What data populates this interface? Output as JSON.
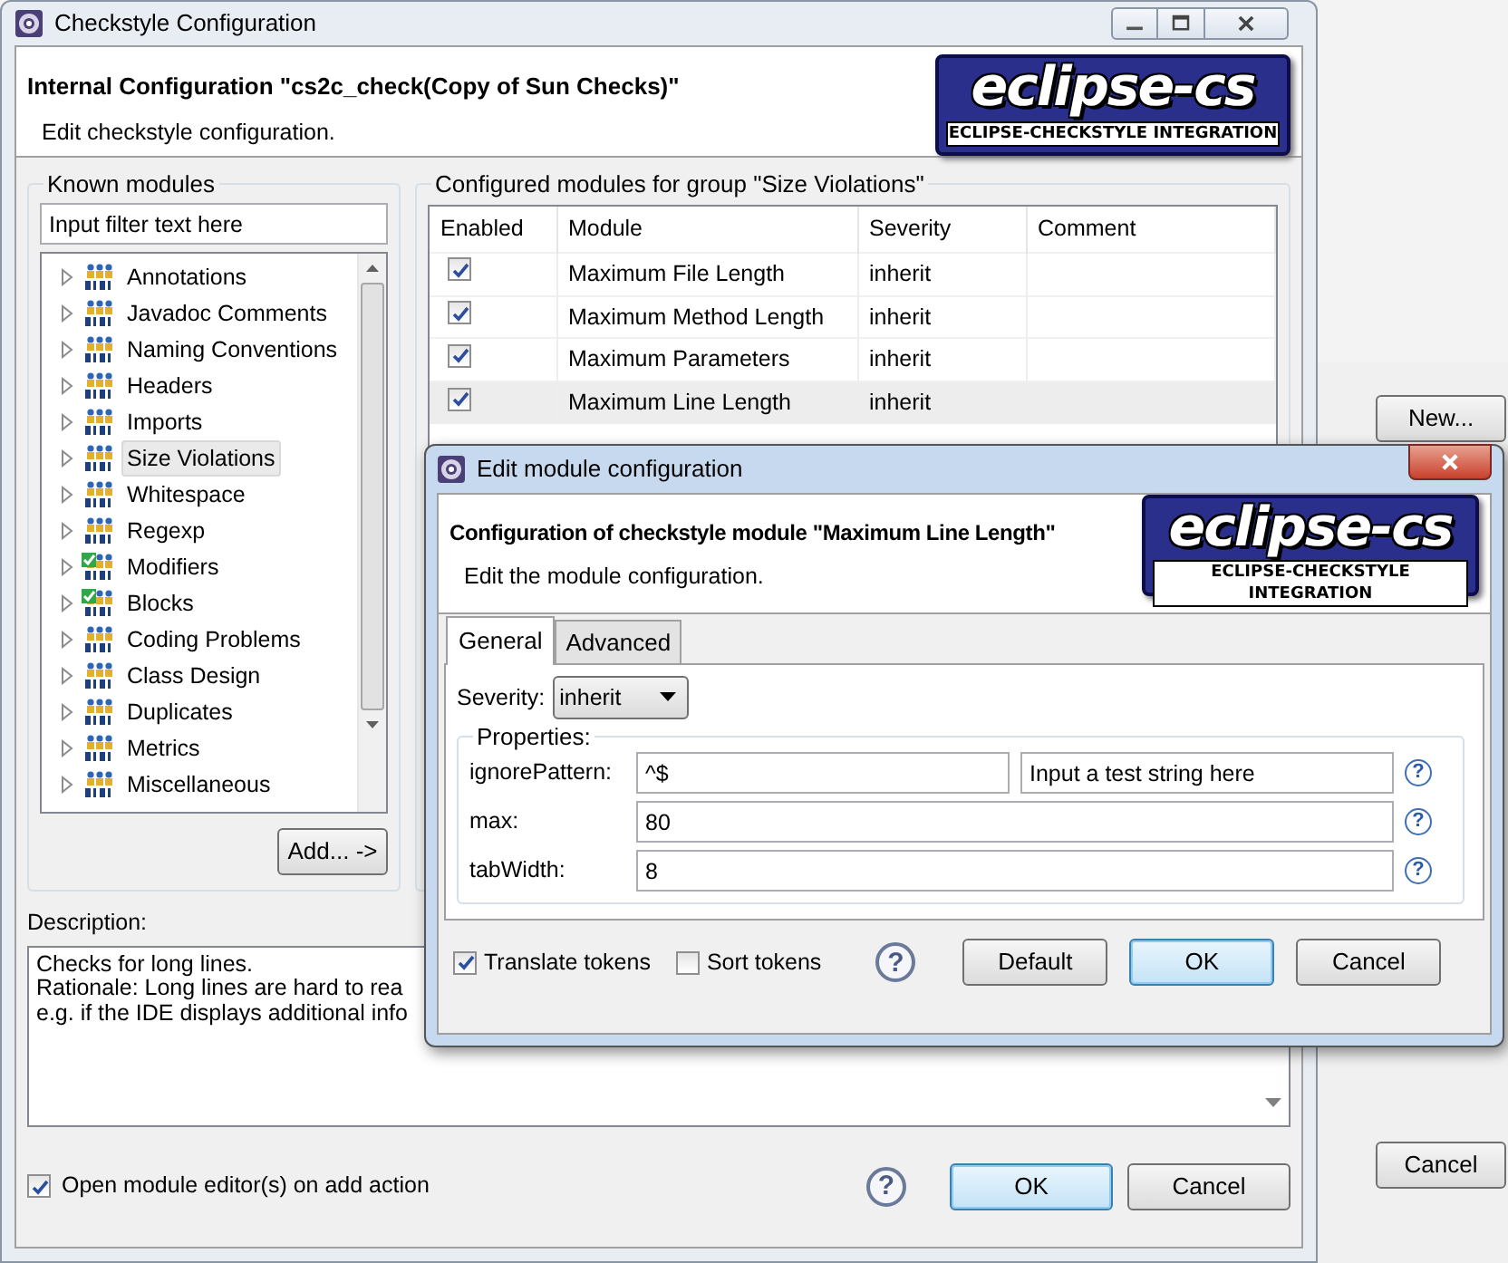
{
  "main_window": {
    "title": "Checkstyle Configuration",
    "header": {
      "title": "Internal Configuration \"cs2c_check(Copy of Sun Checks)\"",
      "subtitle": "Edit checkstyle configuration.",
      "logo": {
        "title": "eclipse-cs",
        "tagline": "ECLIPSE-CHECKSTYLE INTEGRATION"
      }
    },
    "known_modules": {
      "label": "Known modules",
      "filter_placeholder": "Input filter text here",
      "items": [
        {
          "label": "Annotations",
          "configured": false,
          "expanded": false,
          "selected": false
        },
        {
          "label": "Javadoc Comments",
          "configured": false,
          "expanded": false,
          "selected": false
        },
        {
          "label": "Naming Conventions",
          "configured": false,
          "expanded": false,
          "selected": false
        },
        {
          "label": "Headers",
          "configured": false,
          "expanded": false,
          "selected": false
        },
        {
          "label": "Imports",
          "configured": false,
          "expanded": false,
          "selected": false
        },
        {
          "label": "Size Violations",
          "configured": false,
          "expanded": false,
          "selected": true
        },
        {
          "label": "Whitespace",
          "configured": false,
          "expanded": false,
          "selected": false
        },
        {
          "label": "Regexp",
          "configured": false,
          "expanded": false,
          "selected": false
        },
        {
          "label": "Modifiers",
          "configured": true,
          "expanded": false,
          "selected": false
        },
        {
          "label": "Blocks",
          "configured": true,
          "expanded": false,
          "selected": false
        },
        {
          "label": "Coding Problems",
          "configured": false,
          "expanded": false,
          "selected": false
        },
        {
          "label": "Class Design",
          "configured": false,
          "expanded": false,
          "selected": false
        },
        {
          "label": "Duplicates",
          "configured": false,
          "expanded": false,
          "selected": false
        },
        {
          "label": "Metrics",
          "configured": false,
          "expanded": false,
          "selected": false
        },
        {
          "label": "Miscellaneous",
          "configured": false,
          "expanded": false,
          "selected": false
        }
      ],
      "add_button": "Add... ->"
    },
    "configured_modules": {
      "label": "Configured modules for group \"Size Violations\"",
      "columns": [
        "Enabled",
        "Module",
        "Severity",
        "Comment"
      ],
      "rows": [
        {
          "enabled": true,
          "module": "Maximum File Length",
          "severity": "inherit",
          "selected": false
        },
        {
          "enabled": true,
          "module": "Maximum Method Length",
          "severity": "inherit",
          "selected": false
        },
        {
          "enabled": true,
          "module": "Maximum Parameters",
          "severity": "inherit",
          "selected": false
        },
        {
          "enabled": true,
          "module": "Maximum Line Length",
          "severity": "inherit",
          "selected": true
        }
      ]
    },
    "description": {
      "label": "Description:",
      "lines": [
        "Checks for long lines.",
        "Rationale: Long lines are hard to rea",
        "e.g. if the IDE displays additional info"
      ]
    },
    "open_editor_on_add": {
      "label": "Open module editor(s) on add action",
      "checked": true
    },
    "help_icon": "?",
    "buttons": [
      {
        "label": "OK",
        "default": true
      },
      {
        "label": "Cancel",
        "default": false
      }
    ]
  },
  "dialog": {
    "title": "Edit module configuration",
    "header": {
      "title": "Configuration of checkstyle module \"Maximum Line Length\"",
      "subtitle": "Edit the module configuration.",
      "logo": {
        "title": "eclipse-cs",
        "tagline": "ECLIPSE-CHECKSTYLE INTEGRATION"
      }
    },
    "tabs": [
      {
        "label": "General",
        "selected": true
      },
      {
        "label": "Advanced",
        "selected": false
      }
    ],
    "severity": {
      "label": "Severity:",
      "value": "inherit"
    },
    "properties": {
      "label": "Properties:",
      "items": [
        {
          "name": "ignorePattern:",
          "value": "^$",
          "test_placeholder": "Input a test string here"
        },
        {
          "name": "max:",
          "value": "80"
        },
        {
          "name": "tabWidth:",
          "value": "8"
        }
      ]
    },
    "property_help_icon": "?",
    "options": [
      {
        "label": "Translate tokens",
        "checked": true
      },
      {
        "label": "Sort tokens",
        "checked": false
      }
    ],
    "help_icon": "?",
    "buttons": [
      {
        "label": "Default",
        "default": false
      },
      {
        "label": "OK",
        "default": true
      },
      {
        "label": "Cancel",
        "default": false
      }
    ]
  },
  "background_window": {
    "buttons": [
      {
        "label": "New..."
      },
      {
        "label": "Cancel"
      }
    ]
  }
}
